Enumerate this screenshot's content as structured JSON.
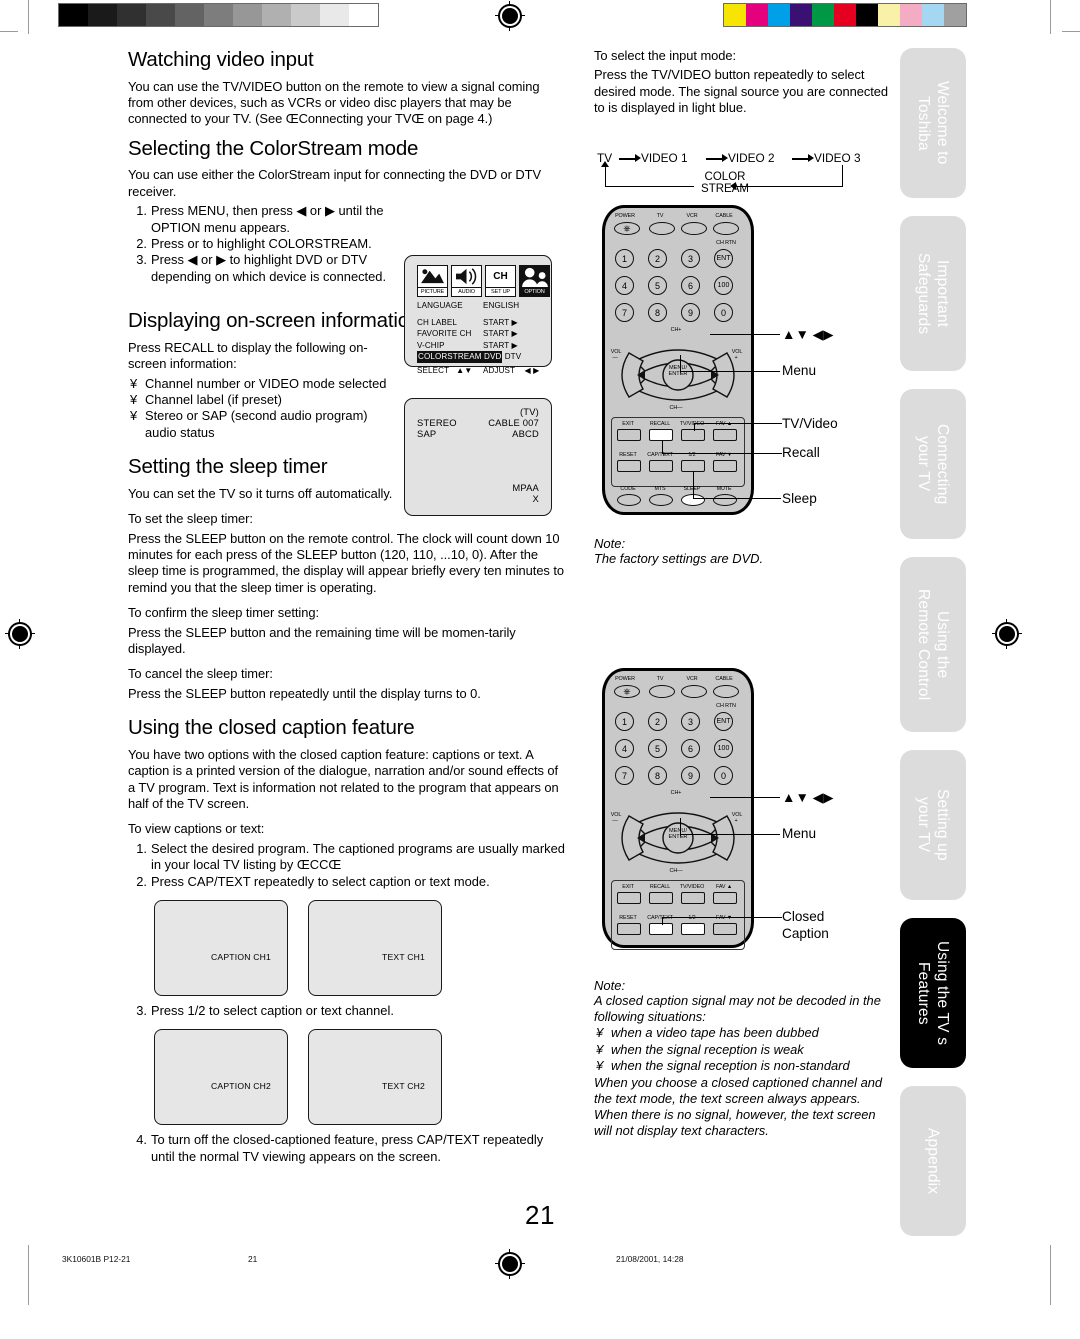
{
  "document": {
    "page_number": "21",
    "footer": {
      "code": "3K10601B P12-21",
      "page": "21",
      "timestamp": "21/08/2001, 14:28"
    }
  },
  "calibration": {
    "gray_ramp": [
      "#000000",
      "#1a1a1a",
      "#303030",
      "#494949",
      "#636363",
      "#7d7d7d",
      "#979797",
      "#b0b0b0",
      "#cacaca",
      "#e9e9e9",
      "#ffffff"
    ],
    "color_bars": [
      "#f6e500",
      "#e5007e",
      "#00a0e9",
      "#3a1173",
      "#009844",
      "#e60020",
      "#000000",
      "#faf1a8",
      "#f4abc4",
      "#a5d7f2",
      "#a0a0a0"
    ]
  },
  "left_column": {
    "section1": {
      "heading": "Watching video input",
      "paragraph": "You can use the TV/VIDEO button on the remote to view a signal coming from other devices, such as VCRs or video disc players that may be connected to your TV. (See ŒConnecting your TVŒ on page 4.)"
    },
    "section2": {
      "heading": "Selecting the ColorStream mode",
      "paragraph": "You can use either the ColorStream input for connecting the DVD or DTV receiver.",
      "steps": [
        {
          "num": "1.",
          "text": "Press MENU, then press ◀ or ▶ until the OPTION menu appears."
        },
        {
          "num": "2.",
          "text": "Press      or      to highlight COLORSTREAM."
        },
        {
          "num": "3.",
          "text": "Press ◀ or ▶ to highlight DVD or DTV depending on which device is connected."
        }
      ]
    },
    "section3": {
      "heading": "Displaying on-screen information",
      "paragraph": "Press RECALL to display the following on-screen information:",
      "bullets": [
        "Channel number or VIDEO mode selected",
        "Channel label (if preset)",
        "Stereo or SAP (second audio program) audio status"
      ],
      "bullet_glyph": "¥"
    },
    "section4": {
      "heading": "Setting the sleep timer",
      "intro": "You can set the TV so it turns off automatically.",
      "blocks": [
        {
          "label": "To set the sleep timer:",
          "text": "Press the SLEEP button on the remote control. The clock will count down 10 minutes for each press of the SLEEP button (120, 110, ...10, 0). After the sleep time is programmed, the display will appear briefly every ten minutes to remind you that the sleep timer is operating."
        },
        {
          "label": "To confirm the sleep timer setting:",
          "text": "Press the SLEEP button and the remaining time will be momen-tarily displayed."
        },
        {
          "label": "To cancel the sleep timer:",
          "text": "Press the SLEEP button repeatedly until the display turns to 0."
        }
      ]
    },
    "section5": {
      "heading": "Using the closed caption feature",
      "paragraph": "You have two options with the closed caption feature: captions or text. A caption is a printed version of the dialogue, narration and/or sound effects of a TV program. Text is information not related to the program that appears on half of the TV screen.",
      "sub_label": "To view captions or text:",
      "steps": [
        {
          "num": "1.",
          "text": "Select the desired program. The captioned programs are usually marked in your local TV listing by ŒCCŒ"
        },
        {
          "num": "2.",
          "text": "Press CAP/TEXT repeatedly to select caption or text mode."
        }
      ],
      "step3": {
        "num": "3.",
        "text": "Press 1/2 to select caption or text channel."
      },
      "step4": {
        "num": "4.",
        "text": "To turn off the closed-captioned feature, press CAP/TEXT repeatedly until the normal TV viewing appears on the screen."
      },
      "screens_row1": [
        "CAPTION CH1",
        "TEXT CH1"
      ],
      "screens_row2": [
        "CAPTION CH2",
        "TEXT CH2"
      ]
    }
  },
  "osd_menu": {
    "icons": [
      {
        "label": "PICTURE",
        "inverted": false,
        "glyph": "picture-icon"
      },
      {
        "label": "AUDIO",
        "inverted": false,
        "glyph": "speaker-icon"
      },
      {
        "label": "SET UP",
        "inverted": false,
        "glyph": "ch-icon",
        "text": "CH"
      },
      {
        "label": "OPTION",
        "inverted": true,
        "glyph": "people-icon"
      }
    ],
    "rows": [
      {
        "key": "LANGUAGE",
        "value": "ENGLISH",
        "highlight": false
      },
      {
        "key": "CH LABEL",
        "value": "START ▶",
        "highlight": false
      },
      {
        "key": "FAVORITE CH",
        "value": "START ▶",
        "highlight": false
      },
      {
        "key": "V-CHIP",
        "value": "START ▶",
        "highlight": false
      },
      {
        "key": "COLORSTREAM",
        "value": "DVD  DTV",
        "highlight": true
      }
    ],
    "footer_row": {
      "select": "SELECT",
      "select_arrows": "▲▼",
      "adjust": "ADJUST",
      "adjust_arrows": "◀ ▶"
    }
  },
  "osd_recall": {
    "mode": "(TV)",
    "audio": "STEREO",
    "sap": "SAP",
    "channel": "CABLE  007",
    "label": "ABCD",
    "rating_title": "MPAA",
    "rating_value": "X"
  },
  "right_column": {
    "intro": {
      "line1": "To select the input mode:",
      "line2": "Press the TV/VIDEO button repeatedly to select desired mode. The signal source you are connected to is displayed in light blue."
    },
    "input_flow": {
      "items": [
        "TV",
        "VIDEO 1",
        "VIDEO 2",
        "VIDEO 3"
      ],
      "loop_label_line1": "COLOR",
      "loop_label_line2": "STREAM"
    },
    "note1": {
      "heading": "Note:",
      "text": "The factory settings are DVD."
    },
    "note2": {
      "heading": "Note:",
      "line1": "A closed caption signal may not be decoded in the following situations:",
      "bullets": [
        "when a video tape has been dubbed",
        "when the signal reception is weak",
        "when the signal reception is non-standard"
      ],
      "bullet_glyph": "¥",
      "line2": "When you choose a closed captioned channel and the text mode, the text screen always appears. When there is no signal, however, the text screen will not display text characters."
    }
  },
  "remote_top": {
    "top_row": [
      "POWER",
      "TV",
      "VCR",
      "CABLE"
    ],
    "ent_label": "CH RTN",
    "ent_text": "ENT",
    "hundred_text": "100",
    "keypad": [
      "1",
      "2",
      "3",
      "4",
      "5",
      "6",
      "7",
      "8",
      "9",
      "0"
    ],
    "ch_up": "CH+",
    "ch_down": "CH—",
    "vol_minus_a": "VOL",
    "vol_minus_b": "—",
    "vol_plus_a": "VOL",
    "vol_plus_b": "+",
    "center_line1": "MENU/",
    "center_line2": "ENTER",
    "row_a": [
      "EXIT",
      "RECALL",
      "TV/VIDEO",
      "FAV ▲"
    ],
    "row_b": [
      "RESET",
      "CAP/TEXT",
      "1/2",
      "FAV ▼"
    ],
    "row_c": [
      "CODE",
      "MTS",
      "SLEEP",
      "MUTE"
    ],
    "callouts": [
      "▲▼ ◀▶",
      "Menu",
      "TV/Video",
      "Recall",
      "Sleep"
    ]
  },
  "remote_bottom": {
    "top_row": [
      "POWER",
      "TV",
      "VCR",
      "CABLE"
    ],
    "ent_label": "CH RTN",
    "ent_text": "ENT",
    "hundred_text": "100",
    "keypad": [
      "1",
      "2",
      "3",
      "4",
      "5",
      "6",
      "7",
      "8",
      "9",
      "0"
    ],
    "ch_up": "CH+",
    "ch_down": "CH—",
    "vol_minus_a": "VOL",
    "vol_minus_b": "—",
    "vol_plus_a": "VOL",
    "vol_plus_b": "+",
    "center_line1": "MENU/",
    "center_line2": "ENTER",
    "row_a": [
      "EXIT",
      "RECALL",
      "TV/VIDEO",
      "FAV ▲"
    ],
    "row_b": [
      "RESET",
      "CAP/TEXT",
      "1/2",
      "FAV ▼"
    ],
    "callouts": [
      "▲▼ ◀▶",
      "Menu",
      "Closed",
      "Caption"
    ]
  },
  "side_tabs": [
    {
      "line1": "Welcome to",
      "line2": "Toshiba",
      "active": false
    },
    {
      "line1": "Important",
      "line2": "Safeguards",
      "active": false
    },
    {
      "line1": "Connecting",
      "line2": "your TV",
      "active": false
    },
    {
      "line1": "Using the",
      "line2": "Remote Control",
      "active": false
    },
    {
      "line1": "Setting up",
      "line2": "your TV",
      "active": false
    },
    {
      "line1": "Using the TV s",
      "line2": "Features",
      "active": true
    },
    {
      "line1": "Appendix",
      "line2": "",
      "active": false
    }
  ]
}
